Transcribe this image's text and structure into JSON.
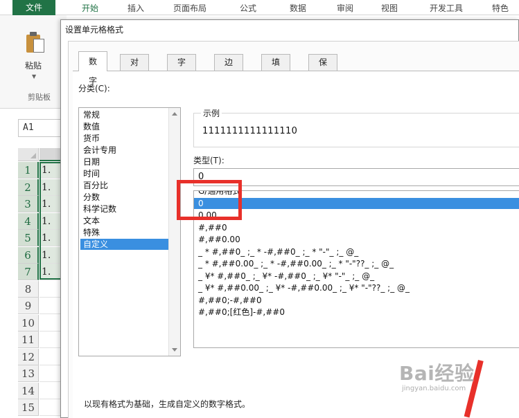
{
  "excel": {
    "file_tab": "文件",
    "ribbon_tabs": [
      "开始",
      "插入",
      "页面布局",
      "公式",
      "数据",
      "审阅",
      "视图",
      "开发工具",
      "特色"
    ],
    "paste_label": "粘贴",
    "clipboard_group": "剪贴板",
    "name_box": "A1",
    "rows": [
      "1",
      "2",
      "3",
      "4",
      "5",
      "6",
      "7",
      "8",
      "9",
      "10",
      "11",
      "12",
      "13",
      "14",
      "15"
    ],
    "cells": [
      "1.",
      "1.",
      "1.",
      "1.",
      "1.",
      "1.",
      "1."
    ]
  },
  "dialog": {
    "title": "设置单元格格式",
    "tabs": [
      "数字",
      "对齐",
      "字体",
      "边框",
      "填充",
      "保护"
    ],
    "active_tab": "数字",
    "category_label": "分类(C):",
    "categories": [
      "常规",
      "数值",
      "货币",
      "会计专用",
      "日期",
      "时间",
      "百分比",
      "分数",
      "科学记数",
      "文本",
      "特殊",
      "自定义"
    ],
    "selected_category": "自定义",
    "sample_label": "示例",
    "sample_value": "1111111111111110",
    "type_label": "类型(T):",
    "type_value": "0",
    "type_list": [
      "G/通用格式",
      "0",
      "0.00",
      "#,##0",
      "#,##0.00",
      "_ * #,##0_ ;_ * -#,##0_ ;_ * \"-\"_ ;_ @_",
      "_ * #,##0.00_ ;_ * -#,##0.00_ ;_ * \"-\"??_ ;_ @_",
      "_ ¥* #,##0_ ;_ ¥* -#,##0_ ;_ ¥* \"-\"_ ;_ @_",
      "_ ¥* #,##0.00_ ;_ ¥* -#,##0.00_ ;_ ¥* \"-\"??_ ;_ @_",
      "#,##0;-#,##0",
      "#,##0;[红色]-#,##0"
    ],
    "selected_type": "0",
    "description": "以现有格式为基础，生成自定义的数字格式。"
  },
  "watermark": {
    "logo": "Bai经验",
    "url": "jingyan.baidu.com"
  },
  "colors": {
    "excel_green": "#217346",
    "selection_blue": "#3a8fe0",
    "annotation_red": "#e8302a"
  }
}
